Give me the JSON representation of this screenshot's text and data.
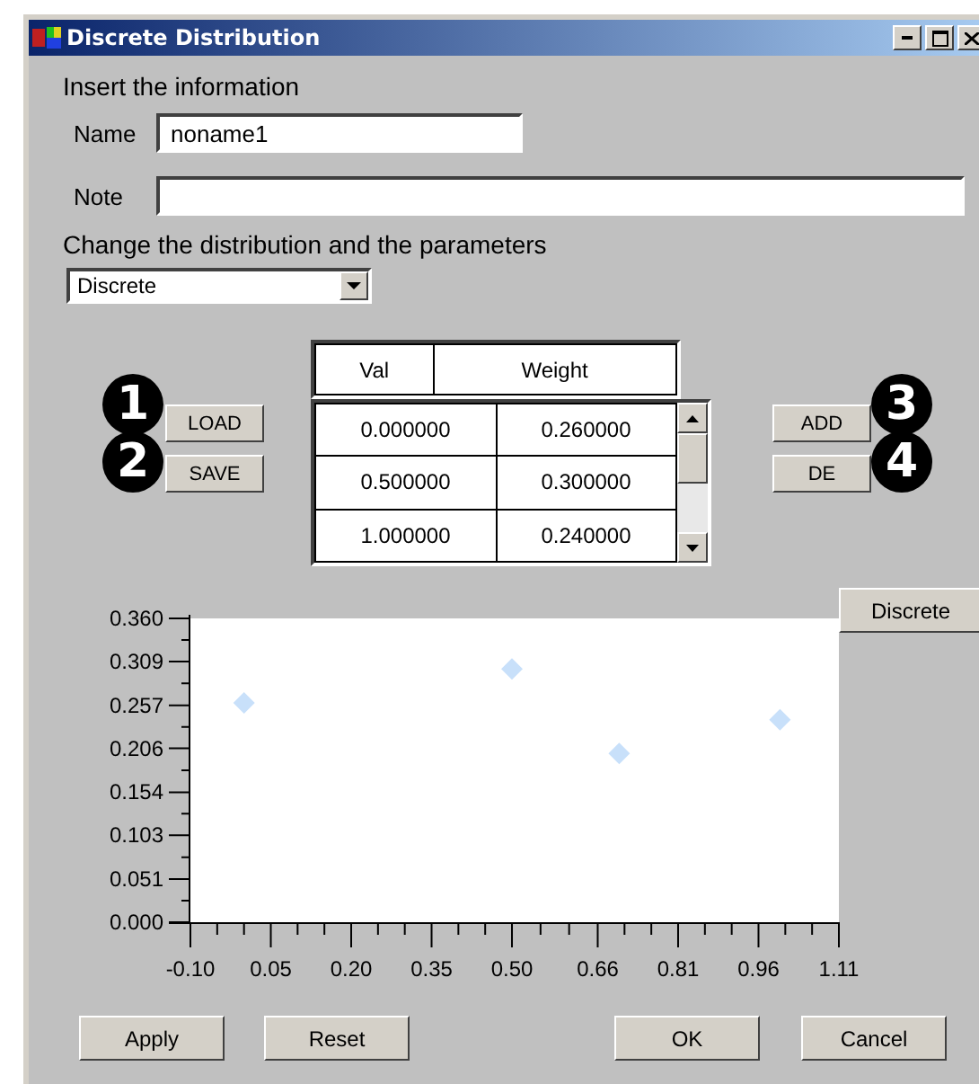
{
  "window": {
    "title": "Discrete Distribution"
  },
  "info_heading": "Insert the information",
  "name_field": {
    "label": "Name",
    "value": "noname1"
  },
  "note_field": {
    "label": "Note"
  },
  "distribution_heading": "Change the distribution and the parameters",
  "distribution_select": {
    "value": "Discrete"
  },
  "left_buttons": [
    {
      "label": "LOAD",
      "callout": "1"
    },
    {
      "label": "SAVE",
      "callout": "2"
    }
  ],
  "right_buttons": [
    {
      "label": "ADD",
      "callout": "3"
    },
    {
      "label": "DE",
      "callout": "4"
    }
  ],
  "table": {
    "columns": [
      "Val",
      "Weight"
    ],
    "rows": [
      [
        "0.000000",
        "0.260000"
      ],
      [
        "0.500000",
        "0.300000"
      ],
      [
        "1.000000",
        "0.240000"
      ]
    ]
  },
  "chart_type_button": "Discrete",
  "chart": {
    "chart_data": {
      "type": "scatter",
      "x": [
        0,
        0.5,
        0.7,
        1.0
      ],
      "series": [
        {
          "color": "#c8e0fa",
          "values": [
            0.26,
            0.3,
            0.2,
            0.24
          ]
        }
      ],
      "xlim": [
        -0.1,
        1.11
      ],
      "ylim": [
        0,
        0.36
      ],
      "xticks": [
        {
          "value": -0.1,
          "label": "-0.10"
        },
        {
          "value": 0.05,
          "label": "0.05"
        },
        {
          "value": 0.2,
          "label": "0.20"
        },
        {
          "value": 0.35,
          "label": "0.35"
        },
        {
          "value": 0.5,
          "label": "0.50"
        },
        {
          "value": 0.66,
          "label": "0.66"
        },
        {
          "value": 0.81,
          "label": "0.81"
        },
        {
          "value": 0.96,
          "label": "0.96"
        },
        {
          "value": 1.11,
          "label": "1.11"
        }
      ],
      "yticks": [
        {
          "value": 0,
          "label": "0.000"
        },
        {
          "value": 0.051,
          "label": "0.051"
        },
        {
          "value": 0.103,
          "label": "0.103"
        },
        {
          "value": 0.154,
          "label": "0.154"
        },
        {
          "value": 0.206,
          "label": "0.206"
        },
        {
          "value": 0.257,
          "label": "0.257"
        },
        {
          "value": 0.309,
          "label": "0.309"
        },
        {
          "value": 0.36,
          "label": "0.360"
        }
      ]
    }
  },
  "bottom_buttons": [
    "Apply",
    "Reset",
    "OK",
    "Cancel"
  ]
}
